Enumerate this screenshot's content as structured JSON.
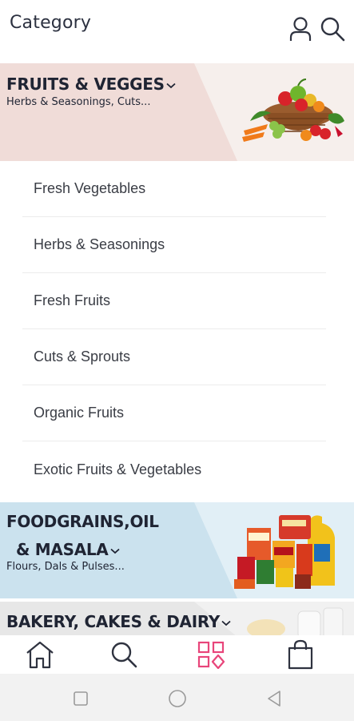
{
  "header": {
    "title": "Category",
    "user_icon": "user-icon",
    "search_icon": "search-icon"
  },
  "categories": [
    {
      "name": "FRUITS & VEGGES",
      "subtitle": "Herbs & Seasonings, Cuts...",
      "expanded": true,
      "accent": "#f0dcd8"
    },
    {
      "name_line1": "FOODGRAINS,OIL",
      "name_line2": "& MASALA",
      "subtitle": "Flours, Dals & Pulses...",
      "expanded": false,
      "accent": "#cbe2ee"
    },
    {
      "name": "BAKERY, CAKES & DAIRY",
      "expanded": false,
      "accent": "#e7e7e7"
    }
  ],
  "subcategories": [
    "Fresh Vegetables",
    "Herbs & Seasonings",
    "Fresh Fruits",
    "Cuts & Sprouts",
    "Organic Fruits",
    "Exotic Fruits & Vegetables"
  ],
  "bottom_nav": {
    "items": [
      "home-icon",
      "search-icon",
      "categories-icon",
      "cart-icon"
    ],
    "active": "categories-icon",
    "active_color": "#e8457a",
    "inactive_color": "#2f3340"
  },
  "system_nav": [
    "recent-apps-icon",
    "home-circle-icon",
    "back-triangle-icon"
  ]
}
